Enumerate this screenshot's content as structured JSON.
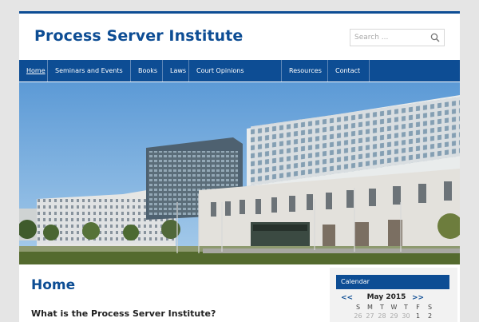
{
  "site": {
    "title": "Process Server Institute"
  },
  "search": {
    "placeholder": "Search ..."
  },
  "nav": {
    "items": [
      {
        "label": "Home"
      },
      {
        "label": "Seminars and Events"
      },
      {
        "label": "Books"
      },
      {
        "label": "Laws"
      },
      {
        "label": "Court Opinions"
      },
      {
        "label": "Resources"
      },
      {
        "label": "Contact"
      }
    ]
  },
  "hero": {
    "icon": "building-photo"
  },
  "content": {
    "title": "Home",
    "subtitle": "What is the Process Server Institute?"
  },
  "sidebar": {
    "widget_title": "Calendar",
    "calendar": {
      "prev": "<<",
      "next": ">>",
      "month": "May 2015",
      "weekdays": [
        "S",
        "M",
        "T",
        "W",
        "T",
        "F",
        "S"
      ],
      "first_row": [
        "26",
        "27",
        "28",
        "29",
        "30",
        "1",
        "2"
      ]
    }
  },
  "colors": {
    "brand": "#0d4d94",
    "background": "#e5e5e5"
  }
}
